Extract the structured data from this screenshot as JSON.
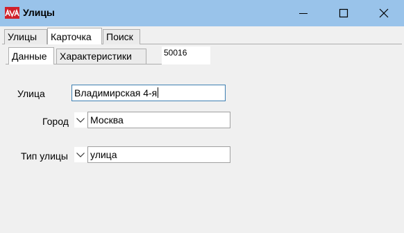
{
  "window": {
    "title": "Улицы",
    "icon": "app-logo-icon",
    "controls": [
      "minimize-icon",
      "maximize-icon",
      "close-icon"
    ]
  },
  "tabs": [
    {
      "label": "Улицы",
      "active": false
    },
    {
      "label": "Карточка",
      "active": true
    },
    {
      "label": "Поиск",
      "active": false
    }
  ],
  "subtabs": [
    {
      "label": "Данные",
      "active": true
    },
    {
      "label": "Характеристики",
      "active": false
    }
  ],
  "record_code": "50016",
  "form": {
    "street": {
      "label": "Улица",
      "value": "Владимирская 4-я"
    },
    "city": {
      "label": "Город",
      "value": "Москва",
      "dropdown_icon": "chevron-down-icon"
    },
    "street_type": {
      "label": "Тип улицы",
      "value": "улица",
      "dropdown_icon": "chevron-down-icon"
    }
  },
  "colors": {
    "titlebar": "#99c3ea",
    "window_bg": "#f0f0f0",
    "logo_red": "#d0202a",
    "focus_border": "#3c7fb1"
  }
}
